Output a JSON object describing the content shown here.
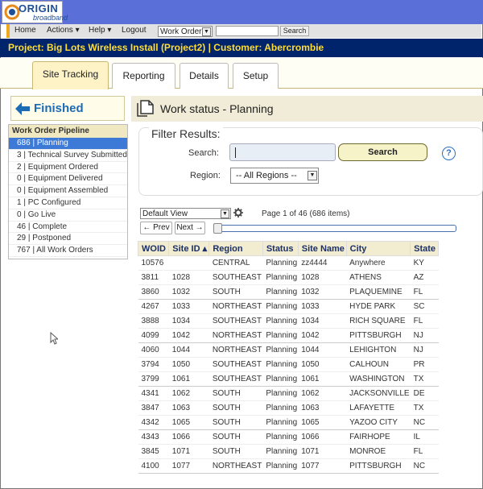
{
  "logo": {
    "line1": "ORIGIN",
    "line2": "broadband"
  },
  "topnav": {
    "home": "Home",
    "actions": "Actions ▾",
    "help": "Help ▾",
    "logout": "Logout",
    "search_type": "Work Order",
    "search_value": "",
    "search_button": "Search"
  },
  "project_title": "Project: Big Lots Wireless Install (Project2) | Customer: Abercrombie",
  "tabs": [
    {
      "label": "Site Tracking",
      "active": true
    },
    {
      "label": "Reporting"
    },
    {
      "label": "Details"
    },
    {
      "label": "Setup"
    }
  ],
  "finished_label": "Finished",
  "pipeline": {
    "header": "Work Order Pipeline",
    "items": [
      "686 | Planning",
      "3 | Technical Survey Submitted",
      "2 | Equipment Ordered",
      "0 | Equipment Delivered",
      "0 | Equipment Assembled",
      "1 | PC Configured",
      "0 | Go Live",
      "46 | Complete",
      "29 | Postponed",
      "767 | All Work Orders"
    ]
  },
  "main_title": "Work status - Planning",
  "filter": {
    "legend": "Filter Results:",
    "search_label": "Search:",
    "search_value": "",
    "search_button": "Search",
    "region_label": "Region:",
    "region_value": "-- All Regions --",
    "help": "?"
  },
  "grid_controls": {
    "view": "Default View",
    "page_info": "Page 1 of 46 (686 items)",
    "prev": "← Prev",
    "next": "Next →",
    "page_fraction": 0.0
  },
  "table": {
    "columns": [
      "WOID",
      "Site ID ▴",
      "Region",
      "Status",
      "Site Name",
      "City",
      "State"
    ],
    "rows": [
      [
        "10576",
        "",
        "CENTRAL",
        "Planning",
        "zz4444",
        "Anywhere",
        "KY"
      ],
      [
        "3811",
        "1028",
        "SOUTHEAST",
        "Planning",
        "1028",
        "ATHENS",
        "AZ"
      ],
      [
        "3860",
        "1032",
        "SOUTH",
        "Planning",
        "1032",
        "PLAQUEMINE",
        "FL"
      ],
      [
        "4267",
        "1033",
        "NORTHEAST",
        "Planning",
        "1033",
        "HYDE PARK",
        "SC"
      ],
      [
        "3888",
        "1034",
        "SOUTHEAST",
        "Planning",
        "1034",
        "RICH SQUARE",
        "FL"
      ],
      [
        "4099",
        "1042",
        "NORTHEAST",
        "Planning",
        "1042",
        "PITTSBURGH",
        "NJ"
      ],
      [
        "4060",
        "1044",
        "NORTHEAST",
        "Planning",
        "1044",
        "LEHIGHTON",
        "NJ"
      ],
      [
        "3794",
        "1050",
        "SOUTHEAST",
        "Planning",
        "1050",
        "CALHOUN",
        "PR"
      ],
      [
        "3799",
        "1061",
        "SOUTHEAST",
        "Planning",
        "1061",
        "WASHINGTON",
        "TX"
      ],
      [
        "4341",
        "1062",
        "SOUTH",
        "Planning",
        "1062",
        "JACKSONVILLE",
        "DE"
      ],
      [
        "3847",
        "1063",
        "SOUTH",
        "Planning",
        "1063",
        "LAFAYETTE",
        "TX"
      ],
      [
        "4342",
        "1065",
        "SOUTH",
        "Planning",
        "1065",
        "YAZOO CITY",
        "NC"
      ],
      [
        "4343",
        "1066",
        "SOUTH",
        "Planning",
        "1066",
        "FAIRHOPE",
        "IL"
      ],
      [
        "3845",
        "1071",
        "SOUTH",
        "Planning",
        "1071",
        "MONROE",
        "FL"
      ],
      [
        "4100",
        "1077",
        "NORTHEAST",
        "Planning",
        "1077",
        "PITTSBURGH",
        "NC"
      ]
    ]
  },
  "colors": {
    "accent": "#3d7ad8",
    "banner": "#5a6fd8",
    "project_bar": "#00246b",
    "project_text": "#ffdd35"
  }
}
